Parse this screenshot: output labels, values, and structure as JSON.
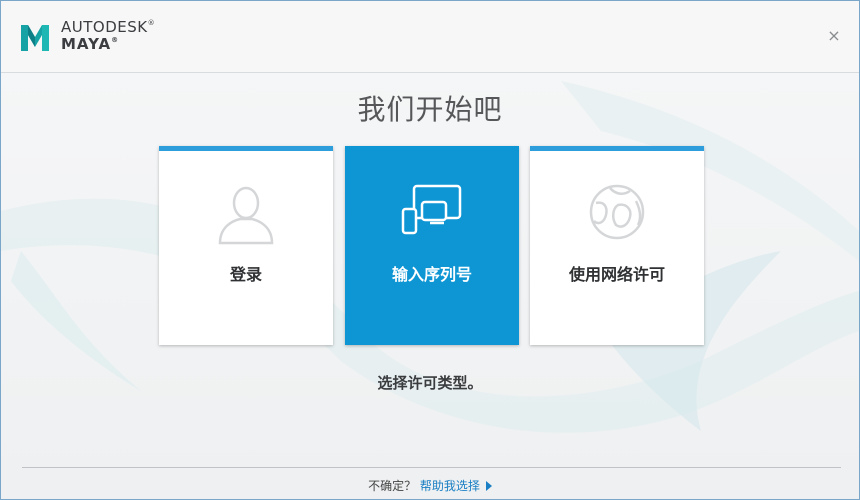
{
  "header": {
    "brand_line1": "AUTODESK",
    "brand_line2": "MAYA",
    "close_glyph": "×"
  },
  "main": {
    "title": "我们开始吧",
    "cards": [
      {
        "label": "登录",
        "icon": "user-silhouette-icon",
        "active": false
      },
      {
        "label": "输入序列号",
        "icon": "devices-icon",
        "active": true
      },
      {
        "label": "使用网络许可",
        "icon": "network-globe-icon",
        "active": false
      }
    ],
    "instruction": "选择许可类型。"
  },
  "footer": {
    "question": "不确定？",
    "help_link": "帮助我选择"
  },
  "colors": {
    "accent": "#2e9ddb",
    "active_card": "#0d95d4",
    "link": "#1a7fc4"
  }
}
